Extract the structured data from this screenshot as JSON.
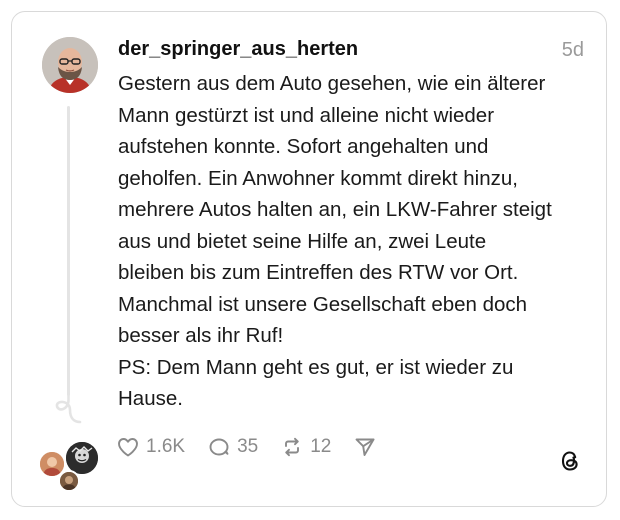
{
  "post": {
    "username": "der_springer_aus_herten",
    "time": "5d",
    "lines": [
      "Gestern aus dem Auto gesehen, wie ein älterer",
      "Mann gestürzt ist und alleine nicht wieder",
      "aufstehen konnte. Sofort angehalten und",
      "geholfen. Ein Anwohner kommt direkt hinzu,",
      "mehrere Autos halten an, ein LKW-Fahrer steigt",
      "aus und bietet seine Hilfe an, zwei Leute",
      "bleiben bis zum Eintreffen des RTW vor Ort.",
      "Manchmal ist unsere Gesellschaft eben doch",
      "besser als ihr Ruf!",
      "PS: Dem Mann geht es gut, er ist wieder zu",
      "Hause."
    ]
  },
  "actions": {
    "likes": "1.6K",
    "replies": "35",
    "reposts": "12"
  },
  "icons": {
    "like": "heart-icon",
    "reply": "comment-icon",
    "repost": "repost-icon",
    "share": "send-icon",
    "brand": "threads-logo-icon"
  },
  "colors": {
    "text": "#1a1a1a",
    "muted": "#8a8a8a",
    "border": "#d9d9d9"
  }
}
